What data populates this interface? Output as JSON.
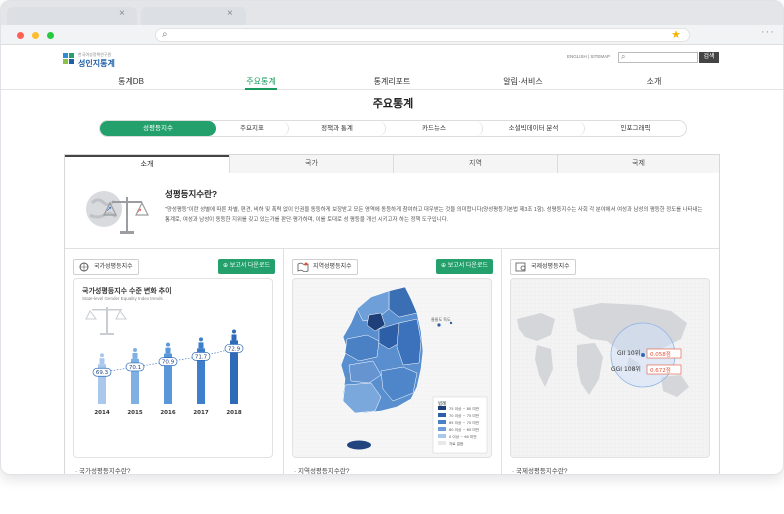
{
  "browser": {
    "tabs": [
      {
        "close": "×"
      },
      {
        "close": "×"
      }
    ],
    "kebab": "···"
  },
  "header": {
    "logo_small": "한국여성정책연구원",
    "logo_big": "성인지통계",
    "util_links": "ENGLISH  |  SITEMAP",
    "search_placeholder": "",
    "search_button": "검색"
  },
  "gnb": [
    "통계DB",
    "주요통계",
    "통계리포트",
    "알림·서비스",
    "소개"
  ],
  "gnb_active": "주요통계",
  "page_title": "주요통계",
  "subtabs": [
    "성평등지수",
    "주요지표",
    "정책과 통계",
    "카드뉴스",
    "소셜빅데이터 분석",
    "인포그래픽"
  ],
  "content_tabs": [
    "소개",
    "국가",
    "지역",
    "국제"
  ],
  "intro": {
    "title": "성평등지수란?",
    "text": "\"양성평등\"이란 성별에 따른 차별, 편견, 비하 및 폭력 없이 인권을 동등하게 보장받고 모든 영역에 동등하게 참여하고 대우받는 것을 의미합니다(양성평등기본법 제3조 1항). 성평등지수는 사회 각 분야에서 여성과 남성의 평등한 정도를 나타내는 통계로, 여성과 남성이 동등한 지위를 갖고 있는가를 판단·평가하며, 이를 토대로 성 평등을 개선 시키고자 하는 정책 도구입니다."
  },
  "cards": {
    "national": {
      "button": "국가성평등지수",
      "download": "보고서 다운로드",
      "chart_title": "국가성평등지수 수준 변화 추이",
      "chart_sub": "State-level Gender Equality Index trends",
      "footer": "국가성평등지수란?"
    },
    "regional": {
      "button": "지역성평등지수",
      "download": "보고서 다운로드",
      "legend_title": "범례",
      "legend": [
        "75 이상 ~ 80 미만",
        "70 이상 ~ 75 미만",
        "65 이상 ~ 70 미만",
        "60 이상 ~ 65 미만",
        "0 이상 ~ 60 미만",
        "자료 없음"
      ],
      "islands": "울릉도  독도",
      "footer": "지역성평등지수란?"
    },
    "international": {
      "button": "국제성평등지수",
      "gii": "GII 10위",
      "gii_val": "0.058점",
      "ggi": "GGI 108위",
      "ggi_val": "0.672점",
      "footer": "국제성평등지수란?"
    }
  },
  "chart_data": {
    "type": "bar",
    "categories": [
      "2014",
      "2015",
      "2016",
      "2017",
      "2018"
    ],
    "values": [
      69.3,
      70.1,
      70.9,
      71.7,
      72.9
    ],
    "title": "국가성평등지수 수준 변화 추이",
    "subtitle": "State-level Gender Equality Index trends",
    "colors": [
      "#a9c8ec",
      "#7fb0e4",
      "#5a97d9",
      "#3d7fca",
      "#2d6bb8"
    ]
  },
  "colors": {
    "accent": "#23a06b",
    "brand_blue": "#1f5fa8"
  }
}
